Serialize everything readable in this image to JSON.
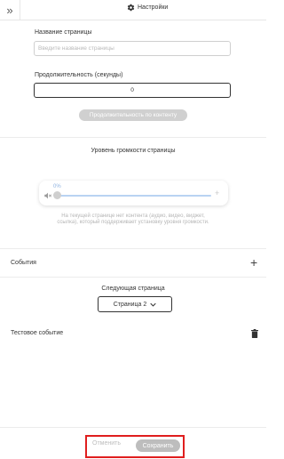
{
  "header": {
    "collapse_glyph": "»",
    "settings_label": "Настройки",
    "settings_icon": "gear-icon"
  },
  "page": {
    "name_label": "Название страницы",
    "name_placeholder": "Введите название страницы",
    "name_value": "",
    "duration_label": "Продолжительность (секунды)",
    "duration_value": "0",
    "duration_by_content_label": "Продолжительность по контенту"
  },
  "volume": {
    "title": "Уровень громкости страницы",
    "level_label": "0%",
    "level": 0,
    "note": "На текущей странице нет контента (аудио, видео, виджет, ссылка), который поддерживает установку уровня громкости."
  },
  "events": {
    "section_label": "События",
    "next_page_label": "Следующая страница",
    "next_page_value": "Страница 2",
    "event_title": "Тестовое событие"
  },
  "footer": {
    "cancel_label": "Отменить",
    "save_label": "Сохранить",
    "highlight_color": "#e01e1e"
  }
}
